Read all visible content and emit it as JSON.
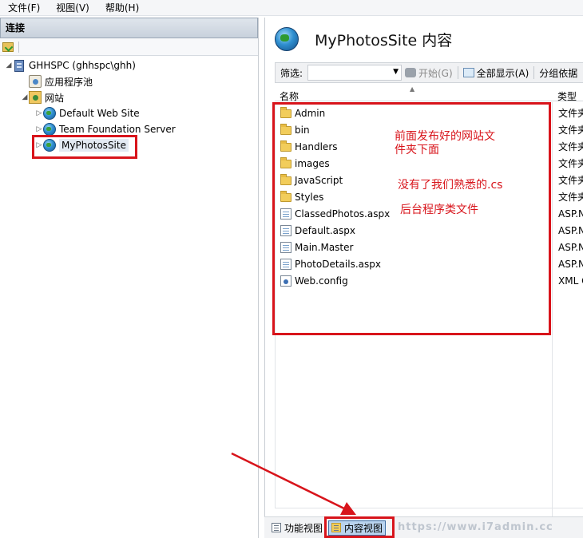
{
  "menu": [
    {
      "label": "文件(F)"
    },
    {
      "label": "视图(V)"
    },
    {
      "label": "帮助(H)"
    }
  ],
  "connections": {
    "header": "连接",
    "tree": {
      "server": "GHHSPC (ghhspc\\ghh)",
      "app_pools": "应用程序池",
      "sites": "网站",
      "site_items": [
        "Default Web Site",
        "Team Foundation Server",
        "MyPhotosSite"
      ]
    }
  },
  "content": {
    "title": "MyPhotosSite 内容",
    "filter_label": "筛选:",
    "filter_value": "",
    "start_button": "开始(G)",
    "show_all_button": "全部显示(A)",
    "group_by_button": "分组依据",
    "col_name": "名称",
    "col_type": "类型",
    "files": [
      {
        "name": "Admin",
        "type": "文件夹",
        "icon": "folder-icon"
      },
      {
        "name": "bin",
        "type": "文件夹",
        "icon": "folder-icon"
      },
      {
        "name": "Handlers",
        "type": "文件夹",
        "icon": "folder-icon"
      },
      {
        "name": "images",
        "type": "文件夹",
        "icon": "folder-icon"
      },
      {
        "name": "JavaScript",
        "type": "文件夹",
        "icon": "folder-icon"
      },
      {
        "name": "Styles",
        "type": "文件夹",
        "icon": "folder-icon"
      },
      {
        "name": "ClassedPhotos.aspx",
        "type": "ASP.NET",
        "icon": "aspx-file-icon"
      },
      {
        "name": "Default.aspx",
        "type": "ASP.NET",
        "icon": "aspx-file-icon"
      },
      {
        "name": "Main.Master",
        "type": "ASP.NET",
        "icon": "master-file-icon"
      },
      {
        "name": "PhotoDetails.aspx",
        "type": "ASP.NET",
        "icon": "aspx-file-icon"
      },
      {
        "name": "Web.config",
        "type": "XML C",
        "icon": "config-file-icon"
      }
    ]
  },
  "annotations": {
    "line1": "前面发布好的网站文",
    "line2": "件夹下面",
    "line3": "没有了我们熟悉的.cs",
    "line4": "后台程序类文件"
  },
  "bottom_bar": {
    "features_view": "功能视图",
    "content_view": "内容视图"
  },
  "watermark": "https://www.i7admin.cc",
  "colors": {
    "annotation_red": "#d8141b",
    "selection_blue": "#b9d3ee"
  }
}
